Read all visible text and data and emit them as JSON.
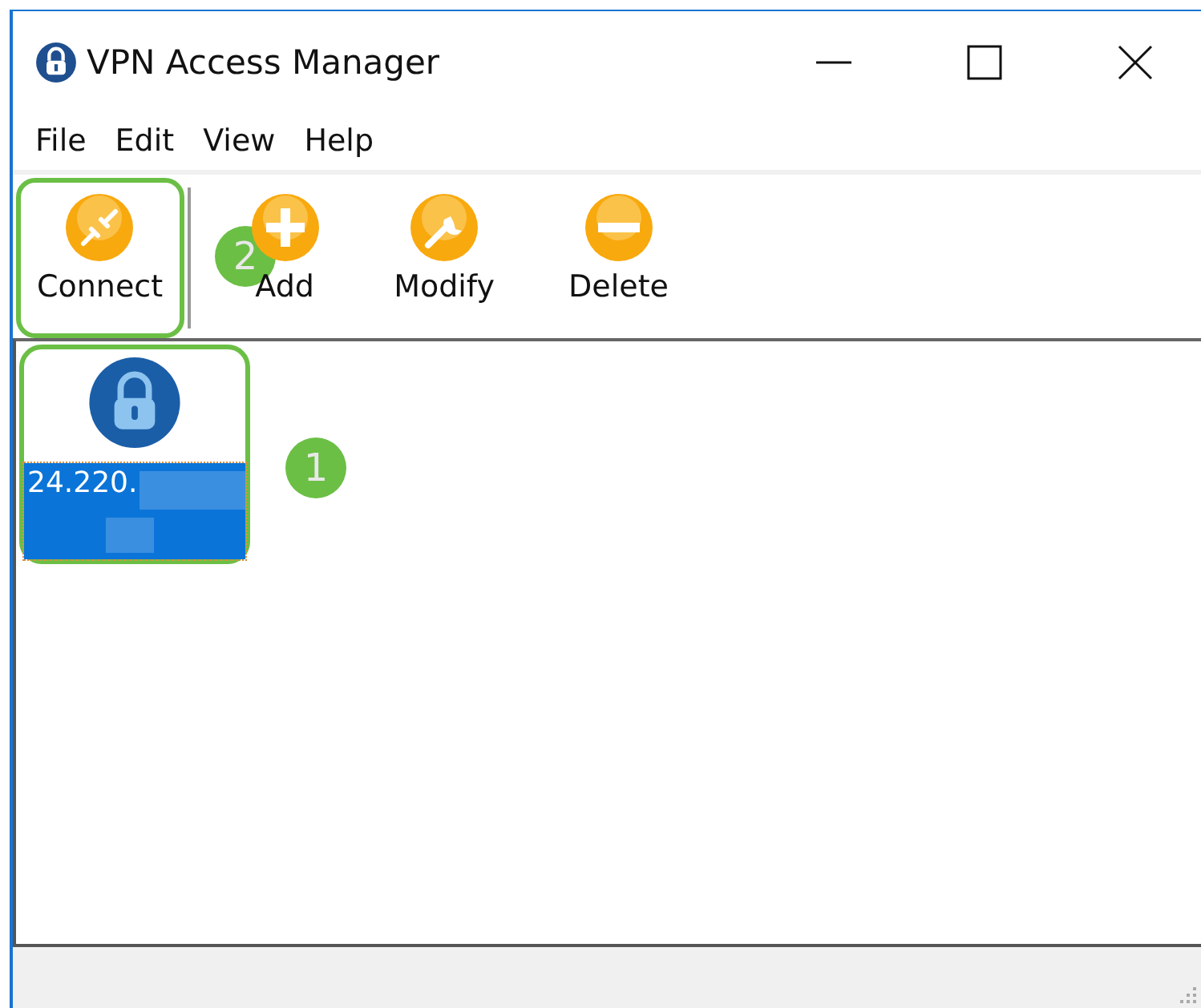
{
  "window": {
    "title": "VPN Access Manager"
  },
  "menu": [
    "File",
    "Edit",
    "View",
    "Help"
  ],
  "toolbar": [
    {
      "label": "Connect",
      "kind": "connect",
      "highlighted": true,
      "callout": "2"
    },
    {
      "label": "Add",
      "kind": "add",
      "highlighted": false
    },
    {
      "label": "Modify",
      "kind": "modify",
      "highlighted": false
    },
    {
      "label": "Delete",
      "kind": "delete",
      "highlighted": false
    }
  ],
  "connections": [
    {
      "label": "24.220.",
      "selected": true,
      "highlighted": true,
      "callout": "1"
    }
  ]
}
